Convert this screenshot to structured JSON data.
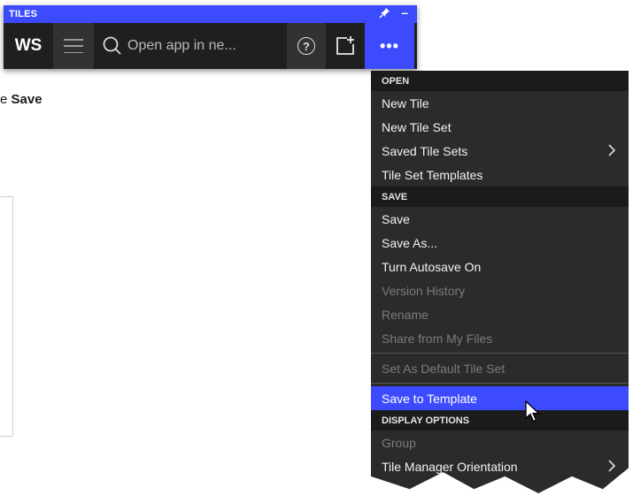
{
  "background": {
    "partial_text_prefix": "e ",
    "partial_text_bold": "Save"
  },
  "tiles_panel": {
    "title": "TILES",
    "pin_icon": "pin-icon",
    "minimize_label": "–",
    "toolbar": {
      "workspace_label": "WS",
      "search_placeholder": "Open app in ne...",
      "help_label": "?",
      "more_label": "•••"
    }
  },
  "menu": {
    "sections": [
      {
        "header": "OPEN",
        "items": [
          {
            "label": "New Tile"
          },
          {
            "label": "New Tile Set"
          },
          {
            "label": "Saved Tile Sets"
          },
          {
            "label": "Tile Set Templates"
          }
        ]
      },
      {
        "header": "SAVE",
        "items": [
          {
            "label": "Save"
          },
          {
            "label": "Save As..."
          },
          {
            "label": "Turn Autosave On"
          },
          {
            "label": "Version History"
          },
          {
            "label": "Rename"
          },
          {
            "label": "Share from My Files"
          },
          {
            "label": "Set As Default Tile Set"
          },
          {
            "label": "Save to Template"
          }
        ]
      },
      {
        "header": "DISPLAY OPTIONS",
        "items": [
          {
            "label": "Group"
          },
          {
            "label": "Tile Manager Orientation"
          }
        ]
      }
    ]
  },
  "colors": {
    "accent": "#3d4bff",
    "toolbar_bg": "#1f1f1f",
    "menu_bg": "#2b2b2b",
    "menu_header_bg": "#1b1b1b",
    "disabled_text": "#7b7b7b"
  }
}
